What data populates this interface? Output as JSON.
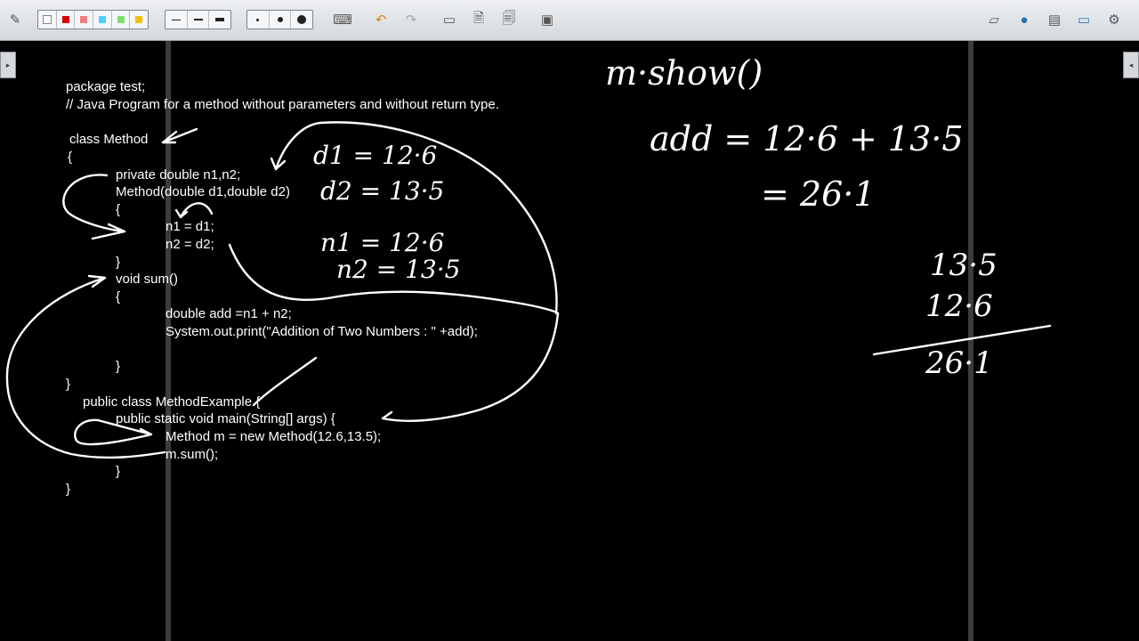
{
  "toolbar": {
    "icons": [
      "pen-icon",
      "color-palette",
      "line-width-group",
      "point-size-group",
      "keyboard-icon",
      "undo-icon",
      "redo-icon",
      "add-page-icon",
      "page-icon",
      "page-copy-icon",
      "screen-capture-icon",
      "eraser-icon",
      "globe-icon",
      "folder-icon",
      "monitor-icon",
      "settings-icon"
    ],
    "colors": [
      "#ffffff",
      "#d40000",
      "#f08080",
      "#4ad0ff",
      "#7ee06a",
      "#f2c000"
    ]
  },
  "code": {
    "l1": "package test;",
    "l2": "// Java Program for a method without parameters and without return type.",
    "l3": "class Method",
    "l4": "{",
    "l5": "private double n1,n2;",
    "l6": "Method(double d1,double d2)",
    "l7": "{",
    "l8": "n1 = d1;",
    "l9": "n2 = d2;",
    "l10": "}",
    "l11": "void sum()",
    "l12": "{",
    "l13": "double add =n1 + n2;",
    "l14": "System.out.print(\"Addition of Two Numbers : \" +add);",
    "l15": "}",
    "l16": "}",
    "l17": "public class MethodExample {",
    "l18": "public static void main(String[] args) {",
    "l19": "Method m = new Method(12.6,13.5);",
    "l20": "m.sum();",
    "l21": "}",
    "l22": "}"
  },
  "notes": {
    "d1": "d1 = 12·6",
    "d2": "d2 = 13·5",
    "n1": "n1 = 12·6",
    "n2": "n2 = 13·5",
    "show": "m·show()",
    "add": "add = 12·6 + 13·5",
    "result": "= 26·1",
    "top": "13·5",
    "bottom": "12·6",
    "sum": "26·1"
  }
}
